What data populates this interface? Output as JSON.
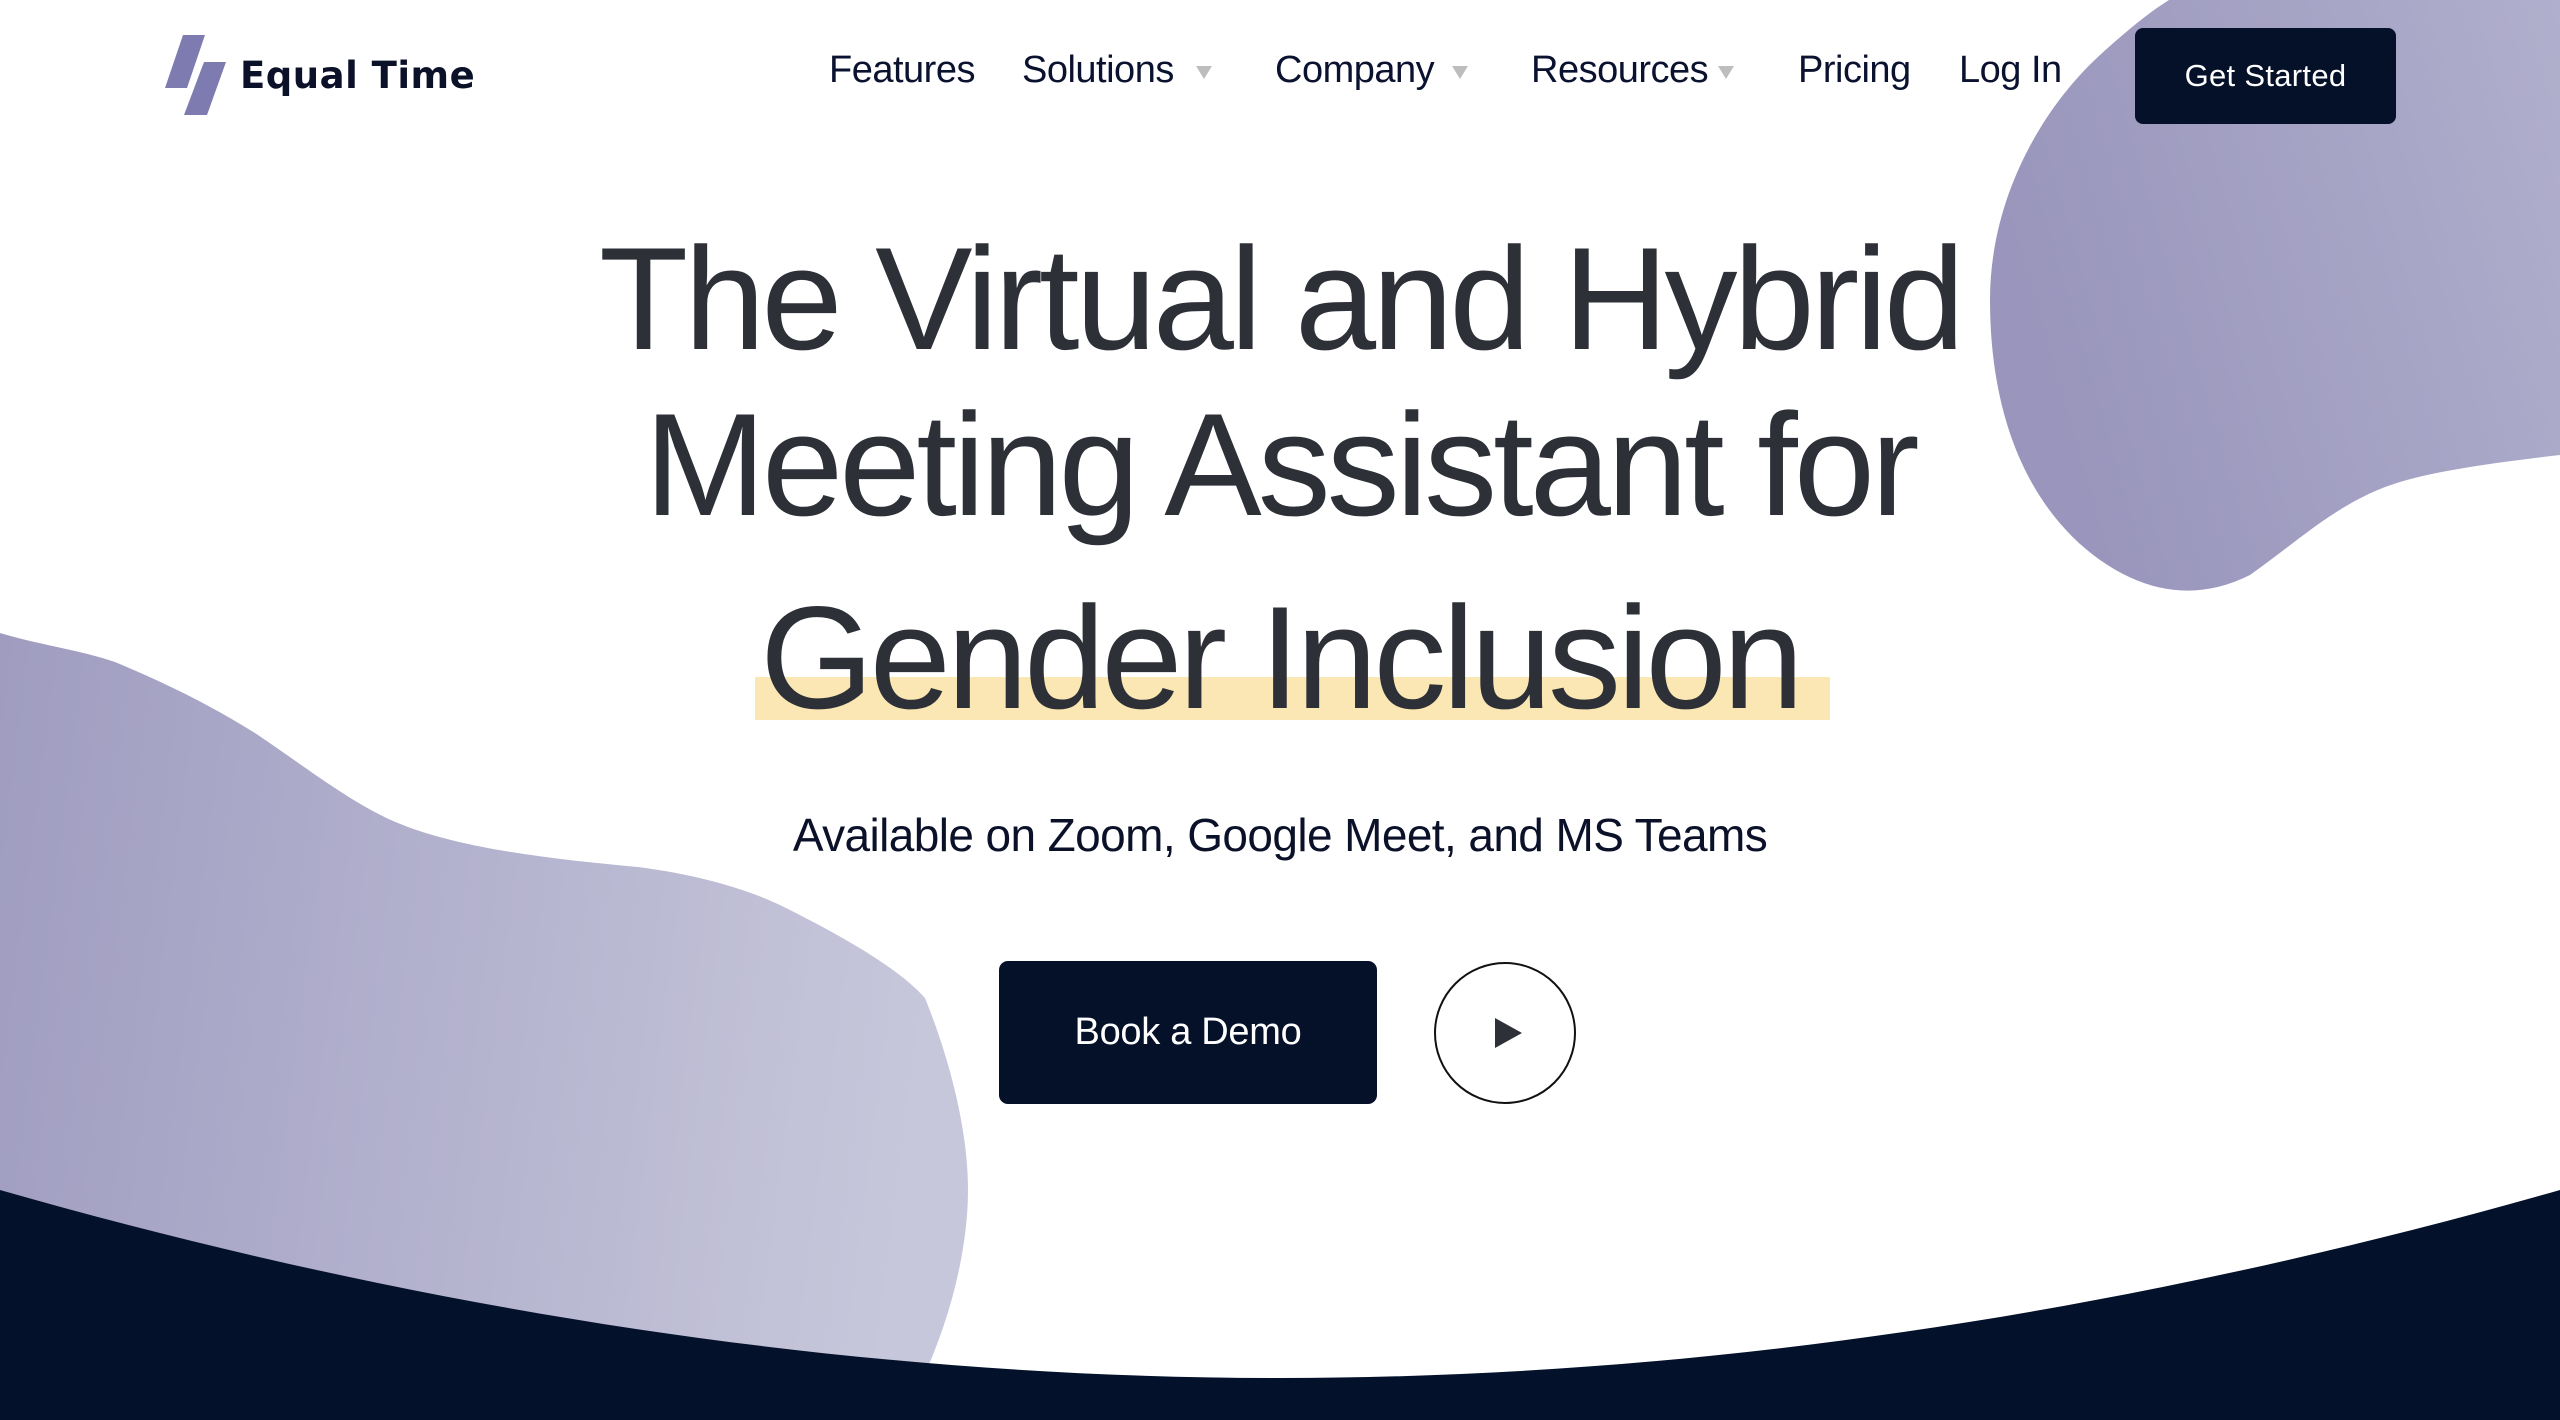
{
  "brand": {
    "name": "Equal Time",
    "logo_icon": "slash-bars-logo",
    "logo_color": "#7e7bb0"
  },
  "nav": {
    "items": [
      {
        "label": "Features",
        "has_dropdown": false
      },
      {
        "label": "Solutions",
        "has_dropdown": true
      },
      {
        "label": "Company",
        "has_dropdown": true
      },
      {
        "label": "Resources",
        "has_dropdown": true
      },
      {
        "label": "Pricing",
        "has_dropdown": false
      },
      {
        "label": "Log In",
        "has_dropdown": false
      }
    ],
    "cta_label": "Get Started"
  },
  "hero": {
    "headline_lines": [
      "The Virtual and Hybrid",
      "Meeting Assistant for",
      "Gender Inclusion"
    ],
    "highlighted_line_index": 2,
    "subtitle": "Available on Zoom, Google Meet, and MS Teams",
    "primary_cta_label": "Book a Demo",
    "play_icon": "play-icon"
  },
  "colors": {
    "text_dark": "#2e3038",
    "navy": "#051029",
    "highlight": "#fbe7b3",
    "blob_dark": "#9b98bf",
    "blob_light": "#c6c6da",
    "caret": "#bdbdbd"
  }
}
